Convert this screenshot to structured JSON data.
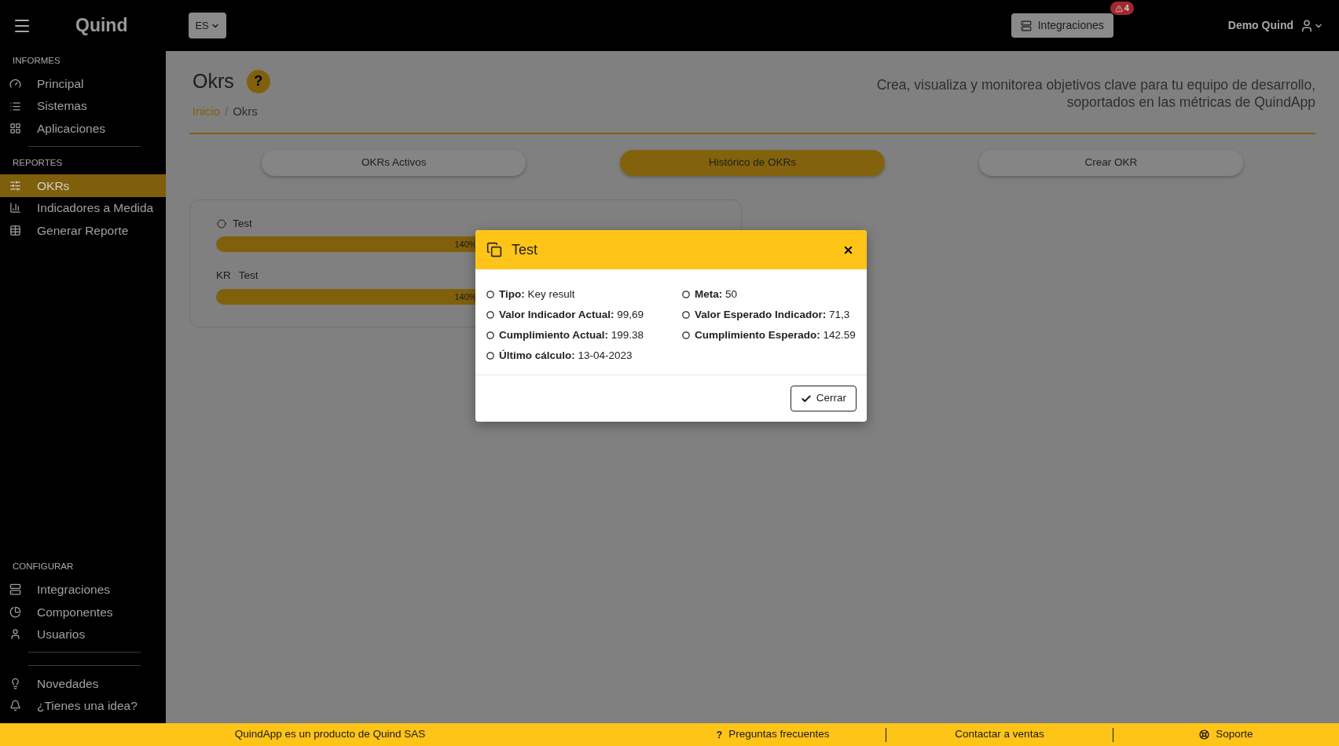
{
  "header": {
    "logo": "Quind",
    "language": "ES",
    "integrations_button": "Integraciones",
    "alert_count": "4",
    "user": "Demo Quind"
  },
  "sidebar": {
    "sections": [
      {
        "title": "INFORMES",
        "items": [
          {
            "label": "Principal",
            "selected": false
          },
          {
            "label": "Sistemas",
            "selected": false
          },
          {
            "label": "Aplicaciones",
            "selected": false
          }
        ]
      },
      {
        "title": "REPORTES",
        "items": [
          {
            "label": "OKRs",
            "selected": true
          },
          {
            "label": "Indicadores a Medida",
            "selected": false
          },
          {
            "label": "Generar Reporte",
            "selected": false
          }
        ]
      },
      {
        "title": "CONFIGURAR",
        "items": [
          {
            "label": "Integraciones",
            "selected": false
          },
          {
            "label": "Componentes",
            "selected": false
          },
          {
            "label": "Usuarios",
            "selected": false
          }
        ]
      },
      {
        "items": [
          {
            "label": "Novedades",
            "selected": false
          },
          {
            "label": "¿Tienes una idea?",
            "selected": false
          }
        ]
      }
    ]
  },
  "page": {
    "title": "Okrs",
    "help": "?",
    "breadcrumb": [
      "Inicio",
      "Okrs"
    ],
    "breadcrumb_separator": "/",
    "description_lines": [
      "Crea, visualiza y monitorea objetivos clave para tu equipo de desarrollo,",
      "soportados en las métricas de QuindApp"
    ]
  },
  "tabs": [
    {
      "label": "OKRs Activos",
      "selected": false
    },
    {
      "label": "Histórico de OKRs",
      "selected": true
    },
    {
      "label": "Crear OKR",
      "selected": false
    }
  ],
  "okrs": [
    {
      "kind": "objective",
      "label": "Test",
      "reading": "140%",
      "level": 1
    },
    {
      "kind": "key_result",
      "prefix": "KR",
      "label": "Test",
      "reading": "140%",
      "level": 1
    }
  ],
  "modal": {
    "title": "Test",
    "columns": [
      [
        {
          "label": "Tipo:",
          "value": "Key result"
        },
        {
          "label": "Valor Indicador Actual:",
          "value": "99,69"
        },
        {
          "label": "Cumplimiento Actual:",
          "value": "199.38"
        },
        {
          "label": "Último cálculo:",
          "value": "13-04-2023"
        }
      ],
      [
        {
          "label": "Meta:",
          "value": "50"
        },
        {
          "label": "Valor Esperado Indicador:",
          "value": "71,3"
        },
        {
          "label": "Cumplimiento Esperado:",
          "value": "142.59"
        }
      ]
    ],
    "button": "Cerrar"
  },
  "footer": {
    "credit": "QuindApp es un producto de Quind SAS",
    "links": [
      {
        "kind": "faq",
        "icon_text": "?",
        "label": "Preguntas frecuentes"
      },
      {
        "kind": "sales",
        "label": "Contactar a ventas"
      },
      {
        "kind": "support",
        "label": "Soporte"
      }
    ]
  }
}
